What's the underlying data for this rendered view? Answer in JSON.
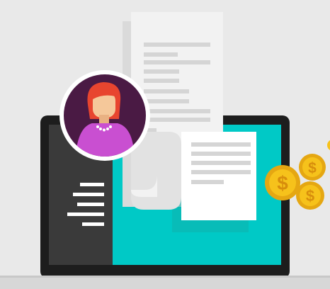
{
  "illustration": {
    "kind": "laptop-invoice-payment-illustration",
    "colors": {
      "background": "#e9e9e9",
      "shadow": "#dadada",
      "laptop_frame": "#1d1d1d",
      "laptop_base": "#d7d7d7",
      "screen_teal": "#00c9c6",
      "screen_dark_panel": "#3a3a3a",
      "paper": "#f2f2f2",
      "paper_white": "#ffffff",
      "paper_lines": "#d5d5d5",
      "avatar_bg": "#4a1a44",
      "avatar_ring": "#ffffff",
      "hair": "#e8452f",
      "skin": "#f5c89a",
      "shirt": "#c94fd1",
      "coin": "#f6c21b",
      "coin_dark": "#e5a712",
      "coin_symbol": "#d88e0c"
    },
    "icons": [
      "laptop-icon",
      "receipt-icon",
      "document-icon",
      "user-avatar-icon",
      "dollar-coin-icon",
      "menu-lines-icon"
    ],
    "coins": [
      {
        "symbol": "$"
      },
      {
        "symbol": "$"
      },
      {
        "symbol": "$"
      }
    ]
  }
}
